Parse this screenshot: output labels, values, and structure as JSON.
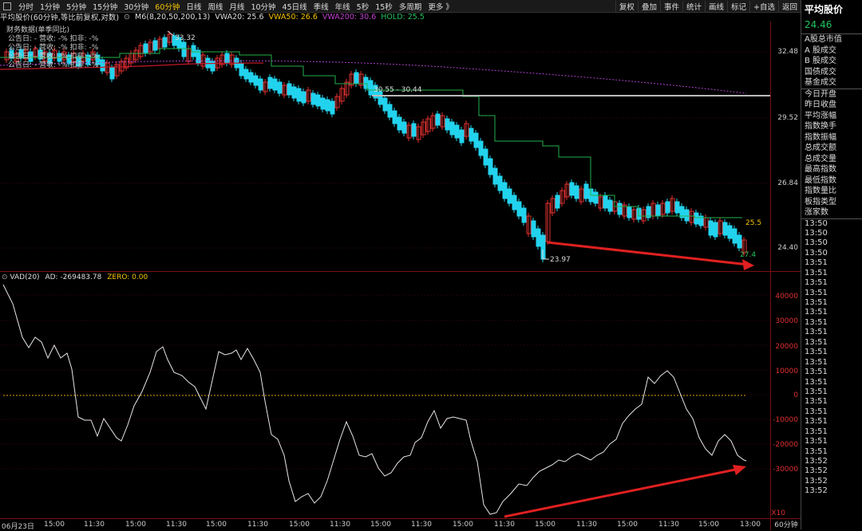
{
  "toolbar": {
    "timeframes": [
      "分时",
      "1分钟",
      "5分钟",
      "15分钟",
      "30分钟",
      "60分钟",
      "日线",
      "周线",
      "月线",
      "10分钟",
      "45日线",
      "季线",
      "年线",
      "5秒",
      "15秒",
      "多周期",
      "更多 》"
    ],
    "active_timeframe": "60分钟",
    "right_tools": [
      "复权",
      "叠加",
      "事件",
      "统计",
      "画线",
      "标记",
      "+自选",
      "返回"
    ]
  },
  "info": {
    "title": "平均股价(60分钟,等比前复权,对数)",
    "ma": "M6(8,20,50,200,13)",
    "vwa20": "VWA20: 25.6",
    "vwa50": "VWA50: 26.6",
    "vwa200": "VWA200: 30.6",
    "hold": "HOLD: 25.5"
  },
  "financial": {
    "title": "财务数据(单季同比)",
    "rows": [
      "公告日: -  营收: -%  扣非: -%",
      "公告日: -  营收: -%  扣非: -%",
      "公告日: -  营收: -%  扣非: -%",
      "公告日: -  营收: -%  扣非: -%"
    ]
  },
  "annotations": {
    "high": "33.32",
    "range": "30.55 - 30.44",
    "low": "23.97",
    "hold_tag": "25.5",
    "last_tag": "27.4"
  },
  "price_axis": [
    "32.48",
    "29.52",
    "26.84",
    "24.40"
  ],
  "vad": {
    "label": "VAD(20)",
    "ad": "AD: -269483.78",
    "zero": "ZERO: 0.00",
    "axis": [
      "40000",
      "30000",
      "20000",
      "10000",
      "0",
      "-10000",
      "-20000",
      "-30000"
    ],
    "unit": "X10"
  },
  "time_axis": [
    "06月23日",
    "15:00",
    "11:30",
    "15:00",
    "11:30",
    "15:00",
    "11:30",
    "15:00",
    "11:30",
    "15:00",
    "11:30",
    "15:00",
    "11:30",
    "15:00",
    "11:30",
    "15:00",
    "11:30",
    "15:00",
    "13:00"
  ],
  "bottom_period": "60分钟",
  "side_panel": {
    "title": "平均股价",
    "price": "24.46",
    "items": [
      "A股总市值",
      "A 股成交",
      "B 股成交",
      "国债成交",
      "基金成交"
    ],
    "items2": [
      "今日开盘",
      "昨日收盘",
      "平均涨幅",
      "指数换手",
      "指数振幅",
      "总成交额",
      "总成交量",
      "最高指数",
      "最低指数",
      "指数量比",
      "板指类型",
      "涨家数"
    ],
    "times": [
      "13:50",
      "13:50",
      "13:50",
      "13:50",
      "13:51",
      "13:51",
      "13:51",
      "13:51",
      "13:51",
      "13:51",
      "13:51",
      "13:51",
      "13:51",
      "13:51",
      "13:51",
      "13:51",
      "13:51",
      "13:51",
      "13:51",
      "13:51",
      "13:51",
      "13:51",
      "13:51",
      "13:51",
      "13:52",
      "13:52",
      "13:52",
      "13:52"
    ]
  },
  "colors": {
    "up": "#e03030",
    "down": "#22d3ee",
    "green_line": "#22b14c",
    "purple": "#b040d0",
    "red_ma": "#c01828",
    "accent": "#f5c400"
  }
}
